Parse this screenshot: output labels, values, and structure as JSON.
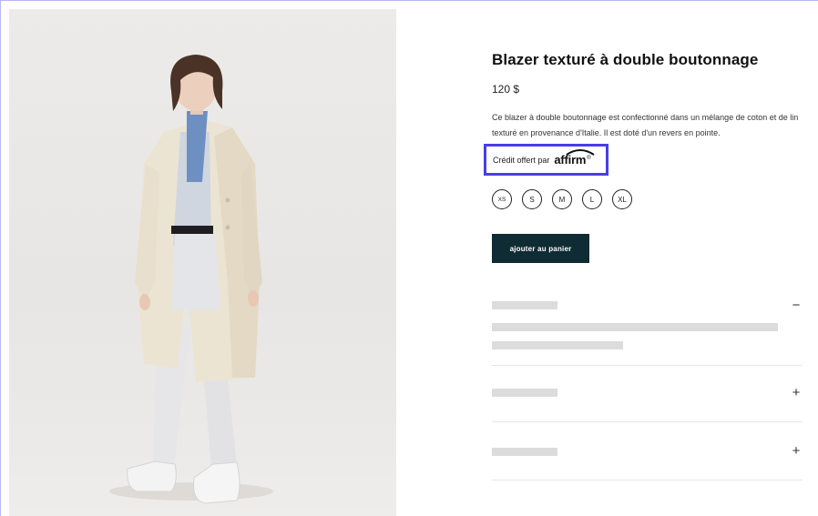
{
  "product": {
    "title": "Blazer texturé à double boutonnage",
    "price": "120 $",
    "description": "Ce blazer à double boutonnage est confectionné dans un mélange de coton et de lin texturé en provenance d'Italie. Il est doté d'un revers en pointe."
  },
  "financing": {
    "label": "Crédit offert par",
    "brand": "affirm",
    "brand_mark": "®",
    "highlight_color": "#4a3de8"
  },
  "sizes": [
    "XS",
    "S",
    "M",
    "L",
    "XL"
  ],
  "cart": {
    "button_label": "ajouter au panier",
    "button_color": "#0f2b33"
  },
  "accordion": {
    "sections": [
      {
        "state": "expanded",
        "toggle_icon": "minus-icon",
        "toggle_symbol": "−"
      },
      {
        "state": "collapsed",
        "toggle_icon": "plus-icon",
        "toggle_symbol": "+"
      },
      {
        "state": "collapsed",
        "toggle_icon": "plus-icon",
        "toggle_symbol": "+"
      }
    ]
  },
  "image": {
    "subject": "Woman in a long cream double-breasted coat, blue turtleneck, light denim shirt, white jeans and white chunky sneakers"
  }
}
